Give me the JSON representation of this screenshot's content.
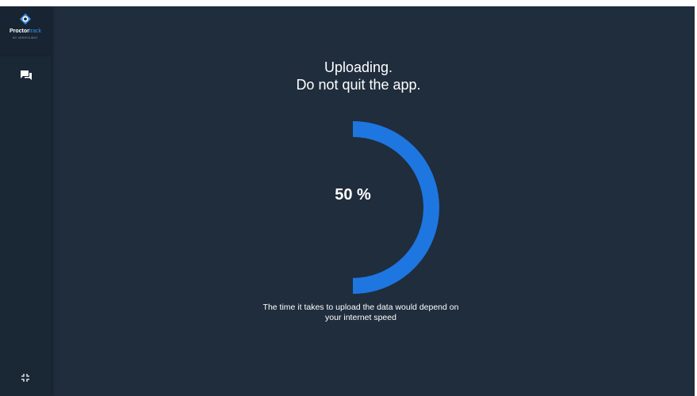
{
  "sidebar": {
    "logo": {
      "brand_primary": "Proctor",
      "brand_accent": "track",
      "tagline": "BY VERIFICIENT",
      "icon": "eye-logo-icon"
    },
    "chat_icon": "chat-icon",
    "collapse_icon": "collapse-icon"
  },
  "upload": {
    "title_line1": "Uploading.",
    "title_line2": "Do not quit the app.",
    "progress_percent": 50,
    "progress_label": "50 %",
    "note_line1": "The time it takes to upload the data would depend on",
    "note_line2": "your internet speed"
  },
  "colors": {
    "background": "#1f2d3d",
    "sidebar": "#1a2735",
    "accent": "#1e76e0",
    "text": "#ffffff"
  }
}
